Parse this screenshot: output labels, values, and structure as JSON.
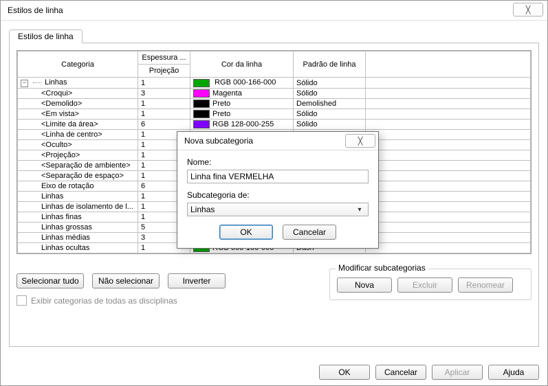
{
  "window": {
    "title": "Estilos de linha"
  },
  "tab": {
    "label": "Estilos de linha"
  },
  "columns": {
    "cat": "Categoria",
    "weight": "Espessura ...",
    "proj": "Projeção",
    "color": "Cor da linha",
    "pattern": "Padrão de linha"
  },
  "root_row": {
    "label": "Linhas",
    "weight": "1",
    "color_name": "RGB 000-166-000",
    "swatch": "#00a600",
    "pattern": "Sólido"
  },
  "rows": [
    {
      "label": "<Croqui>",
      "weight": "3",
      "swatch": "#ff00ff",
      "color_name": "Magenta",
      "pattern": "Sólido"
    },
    {
      "label": "<Demolido>",
      "weight": "1",
      "swatch": "#000000",
      "color_name": "Preto",
      "pattern": "Demolished"
    },
    {
      "label": "<Em vista>",
      "weight": "1",
      "swatch": "#000000",
      "color_name": "Preto",
      "pattern": "Sólido"
    },
    {
      "label": "<Limite da área>",
      "weight": "6",
      "swatch": "#8000ff",
      "color_name": "RGB 128-000-255",
      "pattern": "Sólido"
    },
    {
      "label": "<Linha de centro>",
      "weight": "1",
      "swatch": "",
      "color_name": "",
      "pattern": ""
    },
    {
      "label": "<Oculto>",
      "weight": "1",
      "swatch": "",
      "color_name": "",
      "pattern": ""
    },
    {
      "label": "<Projeção>",
      "weight": "1",
      "swatch": "",
      "color_name": "",
      "pattern": ""
    },
    {
      "label": "<Separação de ambiente>",
      "weight": "1",
      "swatch": "",
      "color_name": "",
      "pattern": ""
    },
    {
      "label": "<Separação de espaço>",
      "weight": "1",
      "swatch": "",
      "color_name": "",
      "pattern": ""
    },
    {
      "label": "Eixo de rotação",
      "weight": "6",
      "swatch": "",
      "color_name": "",
      "pattern": ""
    },
    {
      "label": "Linhas",
      "weight": "1",
      "swatch": "",
      "color_name": "",
      "pattern": ""
    },
    {
      "label": "Linhas de isolamento de l...",
      "weight": "1",
      "swatch": "",
      "color_name": "",
      "pattern": ""
    },
    {
      "label": "Linhas finas",
      "weight": "1",
      "swatch": "",
      "color_name": "",
      "pattern": ""
    },
    {
      "label": "Linhas grossas",
      "weight": "5",
      "swatch": "",
      "color_name": "",
      "pattern": ""
    },
    {
      "label": "Linhas médias",
      "weight": "3",
      "swatch": "",
      "color_name": "",
      "pattern": ""
    },
    {
      "label": "Linhas ocultas",
      "weight": "1",
      "swatch": "#00a600",
      "color_name": "RGB 000-166-000",
      "pattern": "Dash"
    }
  ],
  "buttons": {
    "select_all": "Selecionar tudo",
    "select_none": "Não selecionar",
    "invert": "Inverter"
  },
  "checkbox": {
    "label": "Exibir categorias de todas as disciplinas"
  },
  "group": {
    "title": "Modificar subcategorias",
    "new": "Nova",
    "delete": "Excluir",
    "rename": "Renomear"
  },
  "footer": {
    "ok": "OK",
    "cancel": "Cancelar",
    "apply": "Aplicar",
    "help": "Ajuda"
  },
  "modal": {
    "title": "Nova subcategoria",
    "name_label": "Nome:",
    "name_value": "Linha fina VERMELHA",
    "sub_label": "Subcategoria de:",
    "sub_value": "Linhas",
    "ok": "OK",
    "cancel": "Cancelar"
  }
}
